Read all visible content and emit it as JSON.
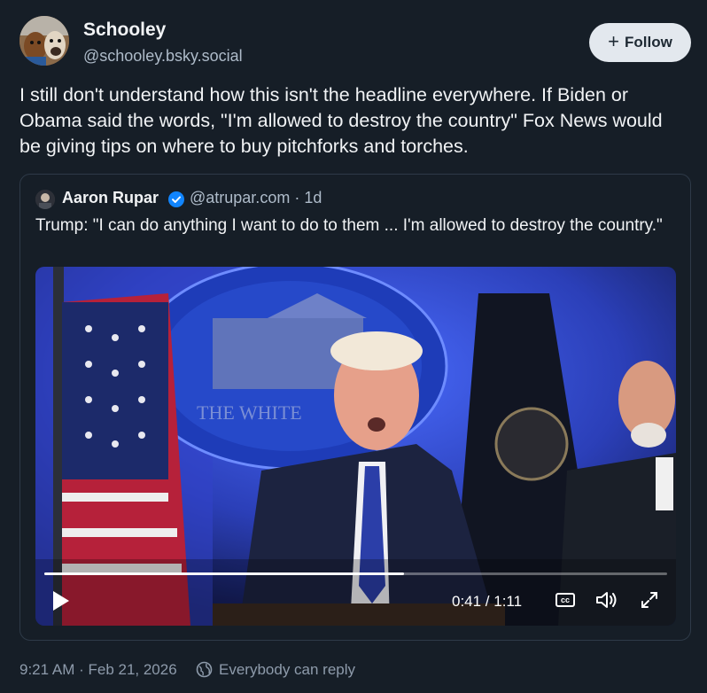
{
  "author": {
    "display_name": "Schooley",
    "handle": "@schooley.bsky.social",
    "avatar_icon": "dogs-avatar-icon"
  },
  "follow_button": {
    "plus": "+",
    "label": "Follow"
  },
  "post": {
    "text": "I still don't understand how this isn't the headline everywhere. If Biden or Obama said the words, \"I'm allowed to destroy the country\" Fox News would be giving tips on where to buy pitchforks and torches."
  },
  "quoted_post": {
    "author_name": "Aaron Rupar",
    "verified_icon": "verified-badge-icon",
    "meta": "@atrupar.com · 1d",
    "text": "Trump: \"I can do anything I want to do to them ... I'm allowed to destroy the country.\""
  },
  "video": {
    "current_time": "0:41",
    "duration": "1:11",
    "time_display": "0:41 / 1:11",
    "progress": 0.577,
    "cc_label": "cc",
    "scene_text": "THE WHITE"
  },
  "footer": {
    "timestamp": "9:21 AM · Feb 21, 2026",
    "reply_setting": "Everybody can reply"
  },
  "colors": {
    "background": "#161e27",
    "accent_blue": "#1185fe",
    "muted_text": "#8e9bab"
  }
}
